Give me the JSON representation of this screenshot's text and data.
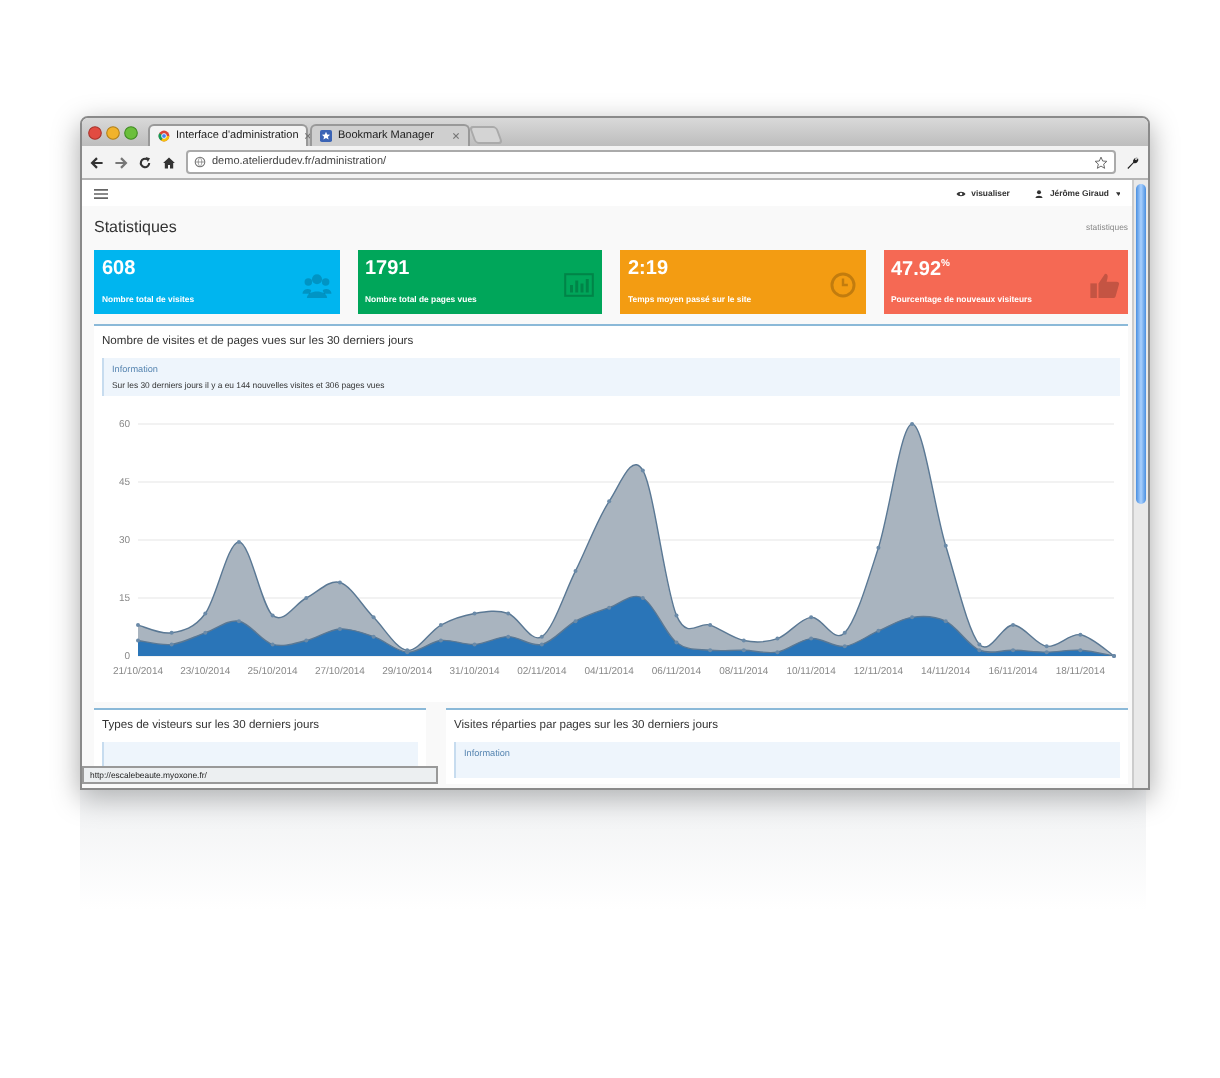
{
  "browser": {
    "tabs": [
      {
        "title": "Interface d'administration",
        "selected": true
      },
      {
        "title": "Bookmark Manager",
        "selected": false
      }
    ],
    "url": "demo.atelierdudev.fr/administration/",
    "status_url": "http://escalebeaute.myoxone.fr/"
  },
  "navbar": {
    "items": [
      {
        "label": "visualiser"
      },
      {
        "label": "Jérôme Giraud"
      }
    ]
  },
  "page": {
    "title": "Statistiques",
    "breadcrumb": "statistiques"
  },
  "cards": [
    {
      "value": "608",
      "label": "Nombre total de visites",
      "color": "#00b5ef"
    },
    {
      "value": "1791",
      "label": "Nombre total de pages vues",
      "color": "#00a65a"
    },
    {
      "value": "2:19",
      "label": "Temps moyen passé sur le site",
      "color": "#f39c12"
    },
    {
      "value": "47.92$^{%}$",
      "label": "Pourcentage de nouveaux visiteurs",
      "color": "#f56954"
    }
  ],
  "chart_panel": {
    "title": "Nombre de visites et de pages vues sur les 30 derniers jours",
    "info_heading": "Information",
    "info_text": "Sur les 30 derniers jours il y a eu 144 nouvelles visites et 306 pages vues",
    "chart_data": {
      "type": "area",
      "stacked": false,
      "categories": [
        "21/10/2014",
        null,
        "23/10/2014",
        null,
        "25/10/2014",
        null,
        "27/10/2014",
        null,
        "29/10/2014",
        null,
        "31/10/2014",
        null,
        "02/11/2014",
        null,
        "04/11/2014",
        null,
        "06/11/2014",
        null,
        "08/11/2014",
        null,
        "10/11/2014",
        null,
        "12/11/2014",
        null,
        "14/11/2014",
        null,
        "16/11/2014",
        null,
        "18/11/2014",
        null
      ],
      "series": [
        {
          "color": "#a9b4bf",
          "values": [
            8,
            6,
            11,
            29.5,
            10.5,
            15,
            19,
            10,
            1.5,
            8,
            11,
            11,
            5,
            22,
            40,
            48,
            10.5,
            8,
            4,
            4.5,
            10,
            6,
            28,
            60,
            28.5,
            3,
            8,
            2.5,
            5.5,
            0
          ]
        },
        {
          "color": "#2a75b8",
          "values": [
            4,
            3,
            6,
            9,
            3,
            4,
            7,
            5,
            1,
            4,
            3,
            5,
            3,
            9,
            12.5,
            15,
            3.5,
            1.5,
            1.5,
            1,
            4.5,
            2.5,
            6.5,
            10,
            9,
            1.5,
            1.5,
            1,
            1.5,
            0
          ]
        }
      ],
      "ylim": [
        0,
        60
      ],
      "yticks": [
        0,
        15,
        30,
        45,
        60
      ],
      "grid": true
    }
  },
  "bottom_panels": [
    {
      "title": "Types de visteurs sur les 30 derniers jours"
    },
    {
      "title": "Visites réparties par pages sur les 30 derniers jours",
      "info_heading": "Information"
    }
  ]
}
